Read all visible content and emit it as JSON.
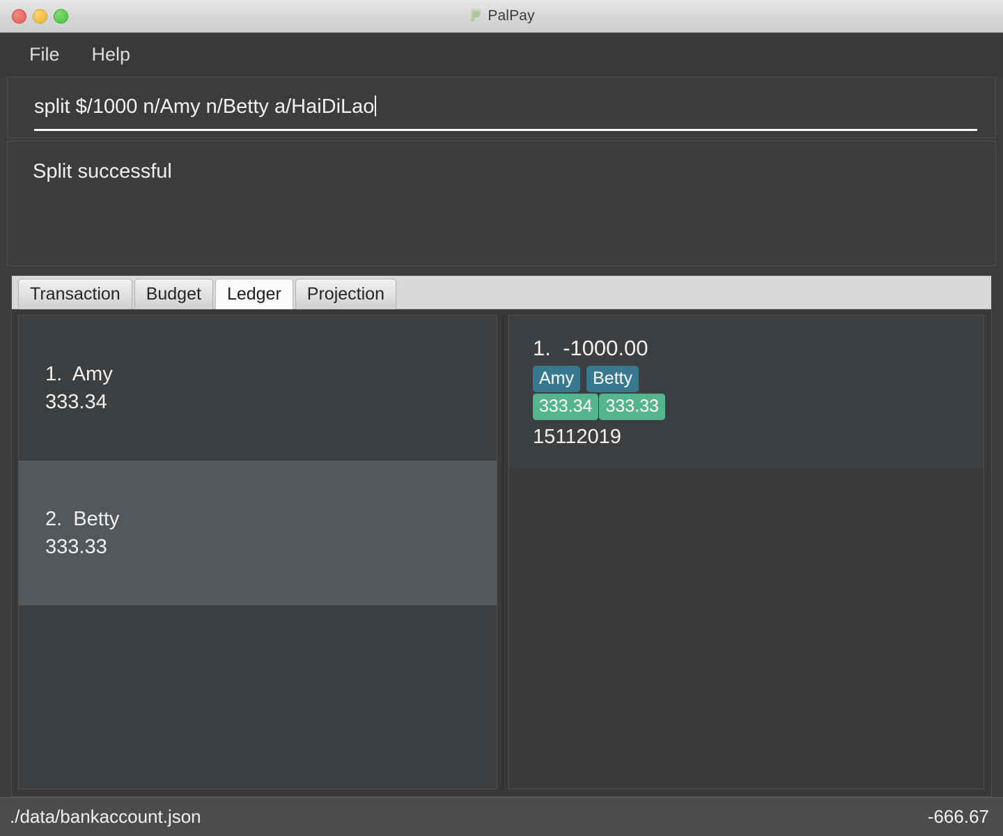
{
  "window": {
    "title": "PalPay",
    "logo_icon": "paypal-p-logo",
    "logo_color": "#bdd3ad",
    "traffic_lights": [
      {
        "name": "close",
        "color": "#e35a53"
      },
      {
        "name": "minimize",
        "color": "#f0b52f"
      },
      {
        "name": "maximize",
        "color": "#45c239"
      }
    ]
  },
  "menu": {
    "items": [
      {
        "label": "File"
      },
      {
        "label": "Help"
      }
    ]
  },
  "command": {
    "value": "split $/1000 n/Amy n/Betty a/HaiDiLao",
    "placeholder": "Enter command here..."
  },
  "result": {
    "message": "Split successful"
  },
  "tabs": [
    {
      "label": "Transaction",
      "selected": false
    },
    {
      "label": "Budget",
      "selected": false
    },
    {
      "label": "Ledger",
      "selected": true
    },
    {
      "label": "Projection",
      "selected": false
    }
  ],
  "ledger_list": {
    "rows": [
      {
        "index": "1.",
        "name": "Amy",
        "amount": "333.34",
        "selected": false
      },
      {
        "index": "2.",
        "name": "Betty",
        "amount": "333.33",
        "selected": true
      }
    ]
  },
  "ledger_detail": {
    "entries": [
      {
        "index": "1.",
        "amount": "-1000.00",
        "people": [
          "Amy",
          "Betty"
        ],
        "shares": [
          "333.34",
          "333.33"
        ],
        "date": "15112019"
      }
    ]
  },
  "status_bar": {
    "file_path": "./data/bankaccount.json",
    "balance": "-666.67"
  },
  "colors": {
    "tag_person": "#38798f",
    "tag_amount": "#55b58f",
    "selected_row": "#52585b",
    "panel_bg": "#3c3f41"
  }
}
